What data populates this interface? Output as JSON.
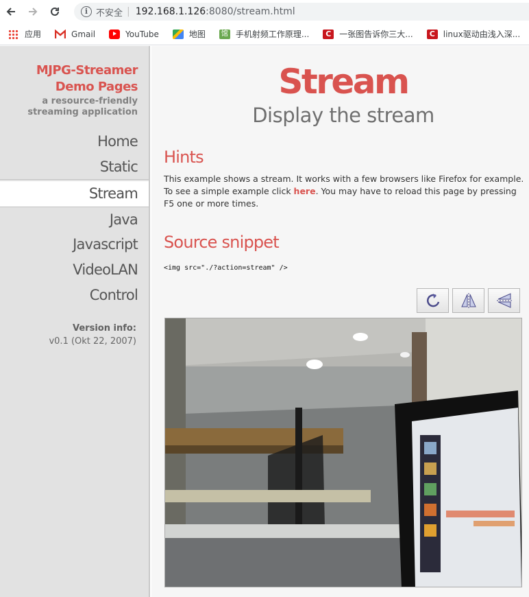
{
  "browser": {
    "security_label": "不安全",
    "url_host": "192.168.1.126",
    "url_rest": ":8080/stream.html",
    "bookmarks": [
      {
        "label": "应用",
        "icon": "apps-grid-icon"
      },
      {
        "label": "Gmail",
        "icon": "gmail-icon"
      },
      {
        "label": "YouTube",
        "icon": "youtube-icon"
      },
      {
        "label": "地图",
        "icon": "maps-icon"
      },
      {
        "label": "手机射频工作原理...",
        "icon": "site-icon"
      },
      {
        "label": "一张图告诉你三大...",
        "icon": "csdn-icon"
      },
      {
        "label": "linux驱动由浅入深...",
        "icon": "csdn-icon"
      }
    ]
  },
  "sidebar": {
    "brand_line1": "MJPG-Streamer",
    "brand_line2": "Demo Pages",
    "brand_sub": "a resource-friendly streaming application",
    "nav": [
      "Home",
      "Static",
      "Stream",
      "Java",
      "Javascript",
      "VideoLAN",
      "Control"
    ],
    "active": "Stream",
    "version_label": "Version info:",
    "version_value": "v0.1 (Okt 22, 2007)"
  },
  "main": {
    "title": "Stream",
    "subtitle": "Display the stream",
    "hints_heading": "Hints",
    "hints_text_1": "This example shows a stream. It works with a few browsers like Firefox for example. To see a simple example click ",
    "hints_link": "here",
    "hints_text_2": ". You may have to reload this page by pressing F5 one or more times.",
    "source_heading": "Source snippet",
    "code": "<img src=\"./?action=stream\" />",
    "toolbar": [
      "rotate-icon",
      "flip-horizontal-icon",
      "flip-vertical-icon"
    ]
  },
  "colors": {
    "accent": "#d9534f",
    "sidebar_bg": "#e2e2e2",
    "main_bg": "#f6f6f6"
  }
}
